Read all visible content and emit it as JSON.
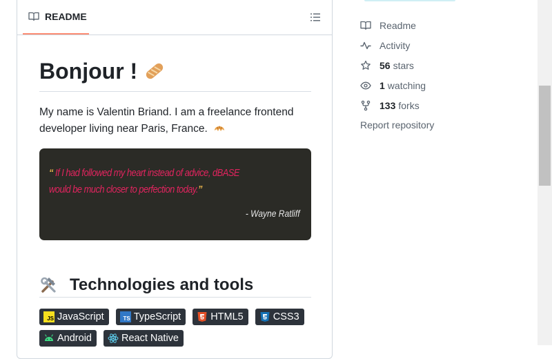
{
  "readme": {
    "tab_label": "README",
    "heading": "Bonjour !",
    "heading_emoji": "baguette",
    "intro": "My name is Valentin Briand. I am a freelance frontend developer living near Paris, France.",
    "intro_emoji": "croissant",
    "quote": {
      "open_mark": "“",
      "text": "If I had followed my heart instead of advice, dBASE would be much closer to perfection today.",
      "close_mark": "”",
      "author": "- Wayne Ratliff"
    },
    "section_heading": "Technologies and tools",
    "section_emoji": "hammer-and-wrench",
    "badges": [
      {
        "label": "JavaScript",
        "icon": "javascript-icon",
        "color": "#f7df1e"
      },
      {
        "label": "TypeScript",
        "icon": "typescript-icon",
        "color": "#3178c6"
      },
      {
        "label": "HTML5",
        "icon": "html5-icon",
        "color": "#e34f26"
      },
      {
        "label": "CSS3",
        "icon": "css3-icon",
        "color": "#1572b6"
      },
      {
        "label": "Android",
        "icon": "android-icon",
        "color": "#3ddc84"
      },
      {
        "label": "React Native",
        "icon": "react-icon",
        "color": "#61dafb"
      }
    ]
  },
  "sidebar": {
    "readme_label": "Readme",
    "activity_label": "Activity",
    "stars_count": "56",
    "stars_label": "stars",
    "watching_count": "1",
    "watching_label": "watching",
    "forks_count": "133",
    "forks_label": "forks",
    "report_label": "Report repository"
  },
  "colors": {
    "tab_underline": "#fd8c73",
    "quote_bg": "#2b2b26",
    "quote_text": "#e0245e",
    "quote_marks": "#e8b34b",
    "badge_bg": "#2d333b"
  }
}
